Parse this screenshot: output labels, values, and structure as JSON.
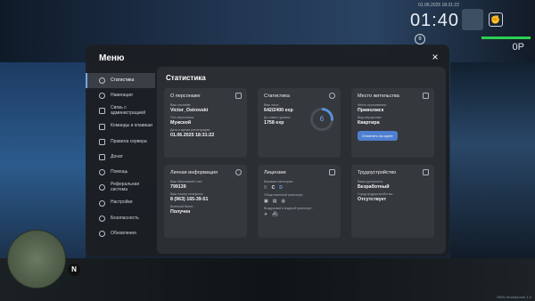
{
  "hud": {
    "time": "01:40",
    "date_time_small": "01.06.2025 18:31:22",
    "armor": "0P",
    "fist_icon": "fist-icon",
    "level_badge": "6",
    "watermark": "SKIN Smartphone 1.0"
  },
  "minimap": {
    "north_label": "N"
  },
  "modal": {
    "title": "Меню",
    "close_label": "×"
  },
  "sidebar": {
    "items": [
      {
        "label": "Статистика",
        "icon": "clock-icon"
      },
      {
        "label": "Навигация",
        "icon": "compass-icon"
      },
      {
        "label": "Связь с администрацией",
        "icon": "chat-icon"
      },
      {
        "label": "Команды и клавиши",
        "icon": "keyboard-icon"
      },
      {
        "label": "Правила сервера",
        "icon": "book-icon"
      },
      {
        "label": "Донат",
        "icon": "wallet-icon"
      },
      {
        "label": "Помощь",
        "icon": "help-icon"
      },
      {
        "label": "Реферальная система",
        "icon": "users-icon"
      },
      {
        "label": "Настройки",
        "icon": "gear-icon"
      },
      {
        "label": "Безопасность",
        "icon": "shield-icon"
      },
      {
        "label": "Обновления",
        "icon": "refresh-icon"
      }
    ]
  },
  "content": {
    "title": "Статистика",
    "about": {
      "title": "О персонаже",
      "nick_label": "Ваш никнейм:",
      "nick": "Victor_Ostrovski",
      "gender_label": "Пол персонажа:",
      "gender": "Мужской",
      "reg_label": "Дата и время регистрации:",
      "reg": "01.06.2025 18:31:22"
    },
    "stats": {
      "title": "Статистика",
      "exp_label": "Ваш опыт:",
      "exp": "642/2400 exp",
      "next_label": "До нового уровня:",
      "next": "1758 exp",
      "level": "6",
      "level_progress": 0.27
    },
    "residence": {
      "title": "Место жительства",
      "place_label": "Место проживания:",
      "place": "Приволжск",
      "property_label": "Вид имущества:",
      "property": "Квартира",
      "map_button": "Отметить на карте"
    },
    "personal": {
      "title": "Личная информация",
      "bank_label": "Ваш банковский счет:",
      "bank": "799139",
      "phone_label": "Ваш номер телефона:",
      "phone": "8 (963) 165-39-51",
      "military_label": "Военный билет:",
      "military": "Получен"
    },
    "licenses": {
      "title": "Лицензии",
      "base_label": "Базовые категории:",
      "categories": [
        "B",
        "C",
        "D"
      ],
      "public_label": "Общественный транспорт:",
      "public_icons": [
        "bus-icon",
        "tram-icon",
        "metro-icon"
      ],
      "air_water_label": "Воздушный и водный транспорт:",
      "air_water_icons": [
        "plane-icon",
        "boat-icon"
      ]
    },
    "employment": {
      "title": "Трудоустройство",
      "position_label": "Ваша должность:",
      "position": "Безработный",
      "city_label": "Город трудоустройства:",
      "city": "Отсутствует"
    }
  }
}
